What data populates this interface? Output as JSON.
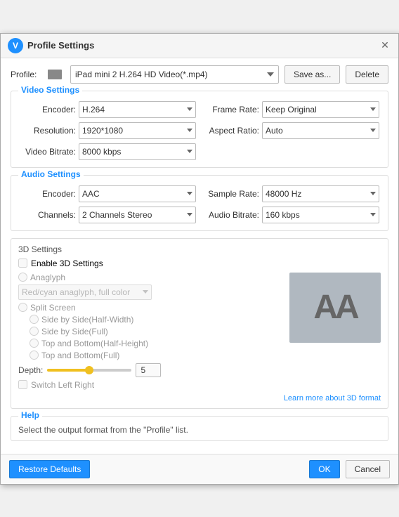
{
  "titleBar": {
    "title": "Profile Settings",
    "closeLabel": "✕",
    "appIconLabel": "V"
  },
  "profile": {
    "label": "Profile:",
    "selectedValue": "iPad mini 2 H.264 HD Video(*.mp4)",
    "saveAsLabel": "Save as...",
    "deleteLabel": "Delete"
  },
  "videoSettings": {
    "sectionTitle": "Video Settings",
    "encoderLabel": "Encoder:",
    "encoderValue": "H.264",
    "resolutionLabel": "Resolution:",
    "resolutionValue": "1920*1080",
    "videoBitrateLabel": "Video Bitrate:",
    "videoBitrateValue": "8000 kbps",
    "frameRateLabel": "Frame Rate:",
    "frameRateValue": "Keep Original",
    "aspectRatioLabel": "Aspect Ratio:",
    "aspectRatioValue": "Auto"
  },
  "audioSettings": {
    "sectionTitle": "Audio Settings",
    "encoderLabel": "Encoder:",
    "encoderValue": "AAC",
    "channelsLabel": "Channels:",
    "channelsValue": "2 Channels Stereo",
    "sampleRateLabel": "Sample Rate:",
    "sampleRateValue": "48000 Hz",
    "audioBitrateLabel": "Audio Bitrate:",
    "audioBitrateValue": "160 kbps"
  },
  "threeDSettings": {
    "sectionTitle": "3D Settings",
    "enableLabel": "Enable 3D Settings",
    "anaglyphLabel": "Anaglyph",
    "anaglyphOption": "Red/cyan anaglyph, full color",
    "splitScreenLabel": "Split Screen",
    "sideByHalfLabel": "Side by Side(Half-Width)",
    "sideByFullLabel": "Side by Side(Full)",
    "topBottomHalfLabel": "Top and Bottom(Half-Height)",
    "topBottomFullLabel": "Top and Bottom(Full)",
    "depthLabel": "Depth:",
    "depthValue": "5",
    "switchLabel": "Switch Left Right",
    "learnMoreLabel": "Learn more about 3D format",
    "previewLabel": "AA"
  },
  "help": {
    "sectionTitle": "Help",
    "helpText": "Select the output format from the \"Profile\" list."
  },
  "footer": {
    "restoreLabel": "Restore Defaults",
    "okLabel": "OK",
    "cancelLabel": "Cancel"
  }
}
